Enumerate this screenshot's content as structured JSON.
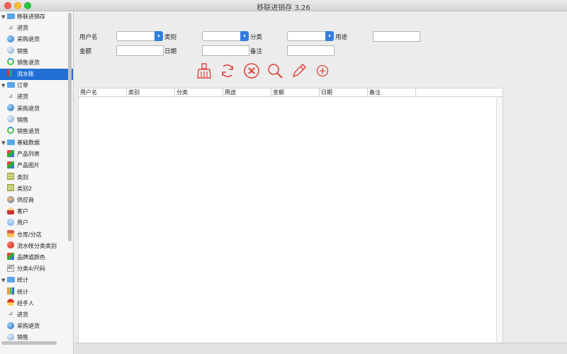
{
  "window": {
    "title": "移联进销存 3.26"
  },
  "sidebar": {
    "groups": [
      {
        "label": "移联进销存",
        "items": [
          {
            "label": "进货",
            "icon": "cart-icon"
          },
          {
            "label": "采购退货",
            "icon": "globe-icon"
          },
          {
            "label": "销售",
            "icon": "coin-icon"
          },
          {
            "label": "销售退货",
            "icon": "refresh-icon"
          },
          {
            "label": "流水账",
            "icon": "ledger-icon",
            "selected": true
          }
        ]
      },
      {
        "label": "订单",
        "items": [
          {
            "label": "进货",
            "icon": "cart-icon"
          },
          {
            "label": "采购退货",
            "icon": "globe-icon"
          },
          {
            "label": "销售",
            "icon": "coin-icon"
          },
          {
            "label": "销售退货",
            "icon": "refresh-icon"
          }
        ]
      },
      {
        "label": "基础数据",
        "items": [
          {
            "label": "产品列表",
            "icon": "blocks-icon"
          },
          {
            "label": "产品图片",
            "icon": "blocks-icon"
          },
          {
            "label": "类别",
            "icon": "list-icon"
          },
          {
            "label": "类别2",
            "icon": "list-icon"
          },
          {
            "label": "供应商",
            "icon": "people-icon"
          },
          {
            "label": "客户",
            "icon": "person-icon"
          },
          {
            "label": "用户",
            "icon": "user-icon"
          },
          {
            "label": "仓库/分店",
            "icon": "house-icon"
          },
          {
            "label": "流水帐分类类别",
            "icon": "red-circle-icon"
          },
          {
            "label": "品牌或颜色",
            "icon": "blocks-icon"
          },
          {
            "label": "分类4/尺码",
            "icon": "size-icon",
            "glyph": "AT"
          }
        ]
      },
      {
        "label": "统计",
        "items": [
          {
            "label": "统计",
            "icon": "bar-chart-icon"
          },
          {
            "label": "经手人",
            "icon": "handshake-icon"
          },
          {
            "label": "进货",
            "icon": "cart-icon"
          },
          {
            "label": "采购退货",
            "icon": "globe-icon"
          },
          {
            "label": "销售",
            "icon": "coin-icon"
          }
        ]
      }
    ]
  },
  "filters": {
    "username_label": "用户名",
    "category_label": "类别",
    "subcategory_label": "分类",
    "purpose_label": "用途",
    "amount_label": "金额",
    "date_label": "日期",
    "note_label": "备注",
    "username_value": "",
    "category_value": "",
    "subcategory_value": "",
    "purpose_value": "",
    "amount_value": "",
    "date_value": "",
    "note_value": ""
  },
  "toolbar": {
    "icons": [
      "broom-icon",
      "refresh-icon",
      "delete-icon",
      "search-icon",
      "edit-icon",
      "add-icon"
    ],
    "colors": {
      "accent": "#e0463e"
    }
  },
  "table": {
    "columns": [
      "用户名",
      "类别",
      "分类",
      "用途",
      "金额",
      "日期",
      "备注"
    ],
    "rows": []
  }
}
